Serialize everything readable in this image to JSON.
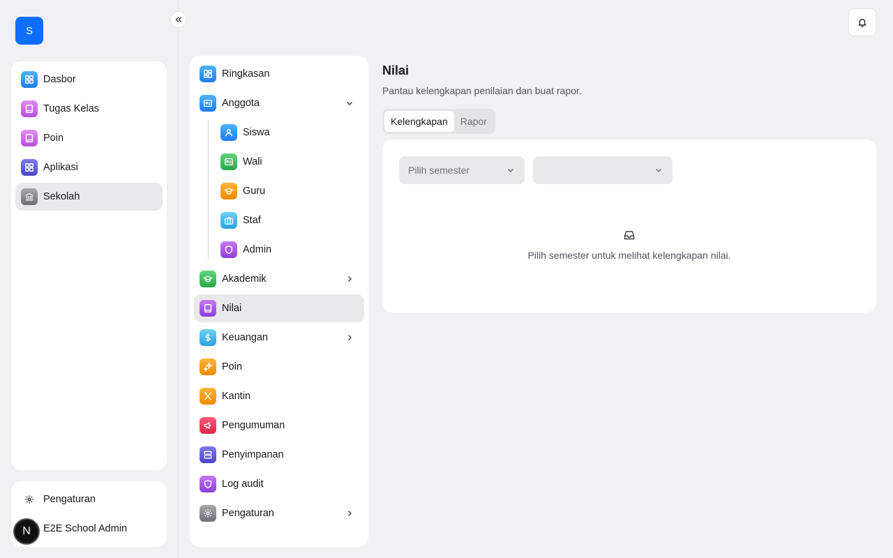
{
  "brand": {
    "initial": "S"
  },
  "sidebar": {
    "items": [
      {
        "label": "Dasbor",
        "icon": "grid-icon"
      },
      {
        "label": "Tugas Kelas",
        "icon": "book-icon"
      },
      {
        "label": "Poin",
        "icon": "book-icon"
      },
      {
        "label": "Aplikasi",
        "icon": "grid-icon"
      },
      {
        "label": "Sekolah",
        "icon": "building-icon",
        "active": true
      }
    ],
    "settings_label": "Pengaturan",
    "user_name": "E2E School Admin",
    "avatar_initial": "N"
  },
  "subnav": {
    "ringkasan": "Ringkasan",
    "anggota": "Anggota",
    "anggota_children": [
      "Siswa",
      "Wali",
      "Guru",
      "Staf",
      "Admin"
    ],
    "akademik": "Akademik",
    "nilai": "Nilai",
    "keuangan": "Keuangan",
    "poin": "Poin",
    "kantin": "Kantin",
    "pengumuman": "Pengumuman",
    "penyimpanan": "Penyimpanan",
    "log_audit": "Log audit",
    "pengaturan": "Pengaturan"
  },
  "main": {
    "title": "Nilai",
    "subtitle": "Pantau kelengkapan penilaian dan buat rapor.",
    "tabs": [
      {
        "label": "Kelengkapan",
        "active": true
      },
      {
        "label": "Rapor",
        "active": false
      }
    ],
    "semester_select": {
      "placeholder": "Pilih semester"
    },
    "second_select": {
      "value": ""
    },
    "empty_message": "Pilih semester untuk melihat kelengkapan nilai."
  },
  "colors": {
    "brand": "#0d6efd",
    "active_bg": "#e9e9eb"
  }
}
